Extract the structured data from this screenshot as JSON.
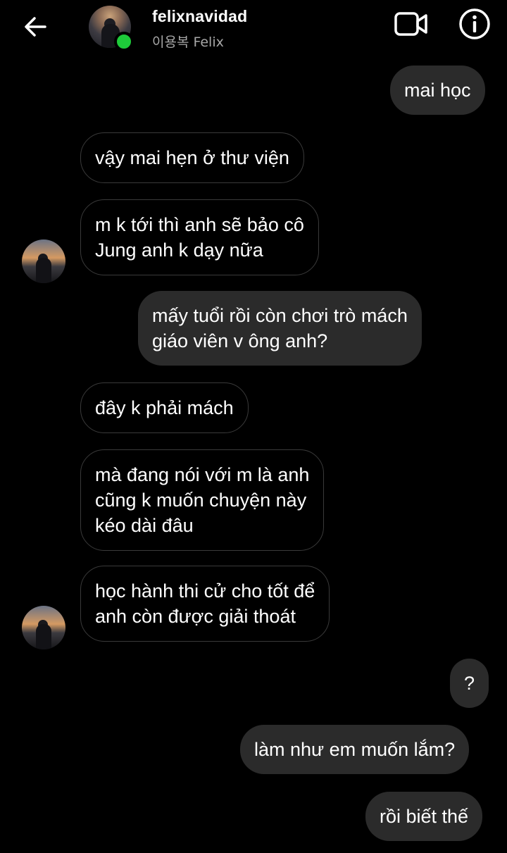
{
  "header": {
    "back_icon": "arrow-left-icon",
    "username": "felixnavidad",
    "subtitle": "이용복 Felix",
    "online_status_color": "#1ecb3a",
    "video_icon": "video-camera-icon",
    "info_icon": "info-icon"
  },
  "colors": {
    "background": "#000000",
    "outgoing_bubble": "#2b2b2b",
    "incoming_border": "#3a3a3a",
    "text": "#ffffff",
    "subtitle": "#a8a8a8"
  },
  "messages": [
    {
      "direction": "outgoing",
      "text": "mai học"
    },
    {
      "direction": "incoming",
      "text": "vậy mai hẹn ở thư viện"
    },
    {
      "direction": "incoming",
      "text": "m k tới thì anh sẽ bảo cô\nJung anh k dạy nữa",
      "avatar": true
    },
    {
      "direction": "outgoing",
      "text": "mấy tuổi rồi còn chơi trò mách\ngiáo viên v ông anh?"
    },
    {
      "direction": "incoming",
      "text": "đây k phải mách"
    },
    {
      "direction": "incoming",
      "text": "mà đang nói với m là anh\ncũng k muốn chuyện này\nkéo dài đâu"
    },
    {
      "direction": "incoming",
      "text": "học hành thi cử cho tốt để\nanh còn được giải thoát",
      "avatar": true
    },
    {
      "direction": "outgoing",
      "text": "?"
    },
    {
      "direction": "outgoing",
      "text": "làm như em muốn lắm?"
    },
    {
      "direction": "outgoing",
      "text": "rồi biết thế"
    }
  ]
}
